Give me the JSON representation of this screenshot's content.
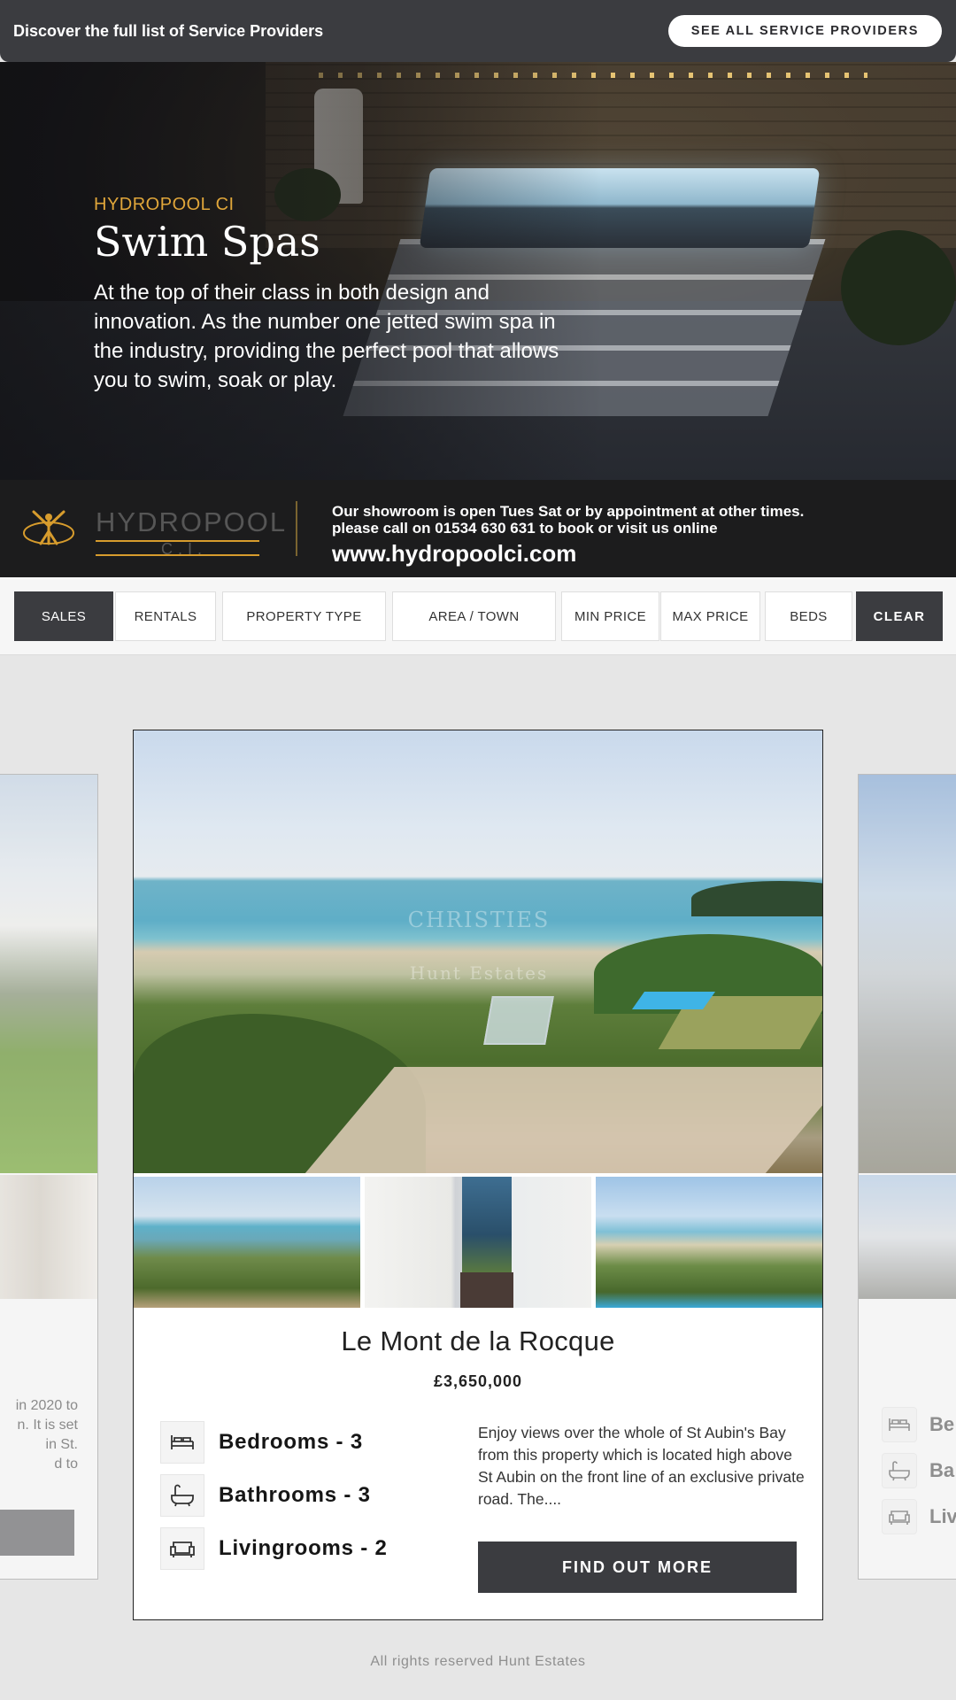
{
  "topbar": {
    "text": "Discover the full list of Service Providers",
    "button_label": "SEE ALL SERVICE PROVIDERS"
  },
  "ad": {
    "brand": "HYDROPOOL CI",
    "title": "Swim Spas",
    "description": "At the top of their class in both design and innovation. As the number one jetted swim spa in the industry, providing the perfect pool that allows you to swim, soak or play.",
    "logo_text": "HYDROPOOL",
    "logo_sub": "C.I.",
    "info_line1": "Our showroom is open Tues Sat or by appointment at other times.",
    "info_line2": "please call on 01534 630 631 to book or visit us online",
    "url": "www.hydropoolci.com",
    "accent_color": "#e0a63a"
  },
  "filters": {
    "items": [
      "SALES",
      "RENTALS",
      "PROPERTY TYPE",
      "AREA / TOWN",
      "MIN PRICE",
      "MAX PRICE",
      "BEDS"
    ],
    "active": "SALES",
    "clear_label": "CLEAR"
  },
  "listing": {
    "title": "Le Mont de la Rocque",
    "price": "£3,650,000",
    "watermark_line1": "CHRISTIES",
    "watermark_line2": "Hunt Estates",
    "features": [
      {
        "icon": "bed-icon",
        "label": "Bedrooms - 3"
      },
      {
        "icon": "bath-icon",
        "label": "Bathrooms - 3"
      },
      {
        "icon": "sofa-icon",
        "label": "Livingrooms - 2"
      }
    ],
    "description": "Enjoy views over the whole of St Aubin's Bay from this property which is located high above St Aubin on the front line of an exclusive private road. The....",
    "button_label": "FIND OUT MORE"
  },
  "left_card": {
    "text_fragment_lines": [
      "in 2020 to",
      "n. It is set",
      "in St.",
      "d to"
    ]
  },
  "right_card": {
    "feature_fragments": [
      "Be",
      "Ba",
      "Liv"
    ]
  },
  "footer": {
    "text": "All rights reserved Hunt Estates"
  },
  "colors": {
    "dark": "#3b3c40",
    "background": "#e6e6e6"
  }
}
